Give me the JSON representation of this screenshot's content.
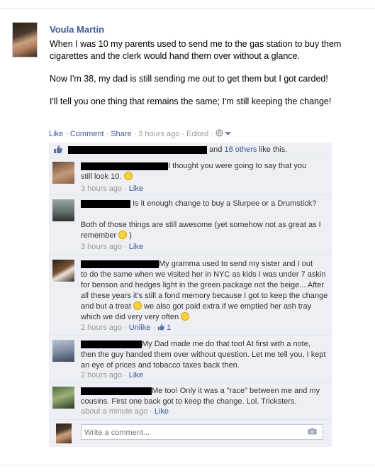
{
  "post": {
    "author": "Voula Martin",
    "paragraphs": [
      "When I was 10 my parents used to send me to the gas station to buy them cigarettes and the clerk would hand them over without a glance.",
      "Now I'm 38, my dad is still sending me out to get them but I got carded!",
      "I'll tell you one thing that remains the same; I'm still keeping the change!"
    ],
    "actions": {
      "like": "Like",
      "comment": "Comment",
      "share": "Share"
    },
    "timestamp": "3 hours ago",
    "edited": "Edited",
    "sep": "·"
  },
  "likes": {
    "and_text": "and",
    "others_link": "18 others",
    "like_text": "like this."
  },
  "comments": [
    {
      "text_a": "I thought you were going to say that you",
      "text_b": "still look 10.",
      "time": "3 hours ago",
      "like": "Like"
    },
    {
      "text_a": "Is it enough change to buy a Slurpee or a Drumstick?",
      "text_b": "Both of those things are still awesome (yet somehow not as great as I remember",
      "text_c": ")",
      "time": "3 hours ago",
      "like": "Like"
    },
    {
      "text_a": "My gramma used to send my sister and I out",
      "text_b": "to do the same when we visited her in NYC as kids I was under 7 askin for benson and hedges light in the green package not the beige... After all these years it's still a fond memory because I got to keep the change and but a treat",
      "text_c": "we also got paid extra if we emptied her ash tray which we did very very often",
      "time": "2 hours ago",
      "unlike": "Unlike",
      "like_count": "1"
    },
    {
      "text_a": "My Dad made me do that too! At first with a note,",
      "text_b": "then the guy handed them over without question. Let me tell you, I kept an eye of prices and tobacco taxes back then.",
      "time": "2 hours ago",
      "like": "Like"
    },
    {
      "text_a": "Me too! Only it was a \"race\" between me and my",
      "text_b": "cousins. First one back got to keep the change. Lol. Tricksters.",
      "time": "about a minute ago",
      "like": "Like"
    }
  ],
  "composer": {
    "placeholder": "Write a comment..."
  },
  "icons": {
    "like": "thumbs-up-icon",
    "globe": "globe-icon",
    "camera": "camera-icon",
    "smile": "smiley-icon"
  },
  "colors": {
    "link": "#3b5998",
    "ufi_bg": "#edeff4",
    "meta": "#999999"
  }
}
